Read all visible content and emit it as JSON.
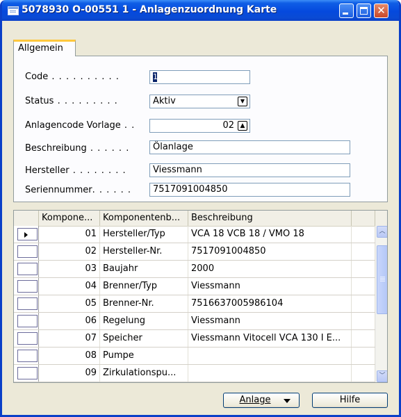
{
  "window": {
    "title": "5078930 O-00551 1 - Anlagenzuordnung Karte"
  },
  "tabs": [
    {
      "label": "Allgemein"
    }
  ],
  "form": {
    "code": {
      "label": "Code",
      "value": "1"
    },
    "status": {
      "label": "Status",
      "value": "Aktiv"
    },
    "anlagencode": {
      "label": "Anlagencode Vorlage",
      "value": "02"
    },
    "beschreibung": {
      "label": "Beschreibung",
      "value": "Ölanlage"
    },
    "hersteller": {
      "label": "Hersteller",
      "value": "Viessmann"
    },
    "seriennummer": {
      "label": "Seriennummer",
      "value": "7517091004850"
    }
  },
  "grid": {
    "headers": [
      "Kompone...",
      "Komponentenb...",
      "Beschreibung"
    ],
    "rows": [
      {
        "nr": "01",
        "komp": "Hersteller/Typ",
        "desc": "VCA 18 VCB 18 / VMO 18"
      },
      {
        "nr": "02",
        "komp": "Hersteller-Nr.",
        "desc": "7517091004850"
      },
      {
        "nr": "03",
        "komp": "Baujahr",
        "desc": "2000"
      },
      {
        "nr": "04",
        "komp": "Brenner/Typ",
        "desc": "Viessmann"
      },
      {
        "nr": "05",
        "komp": "Brenner-Nr.",
        "desc": "7516637005986104"
      },
      {
        "nr": "06",
        "komp": "Regelung",
        "desc": "Viessmann"
      },
      {
        "nr": "07",
        "komp": "Speicher",
        "desc": "Viessmann Vitocell VCA 130 I E..."
      },
      {
        "nr": "08",
        "komp": "Pumpe",
        "desc": ""
      },
      {
        "nr": "09",
        "komp": "Zirkulationspu...",
        "desc": ""
      }
    ]
  },
  "buttons": {
    "anlage": "Anlage",
    "hilfe": "Hilfe"
  },
  "icons": {
    "window": "window-icon",
    "minimize": "minimize-icon",
    "maximize": "maximize-icon",
    "close": "close-icon"
  }
}
